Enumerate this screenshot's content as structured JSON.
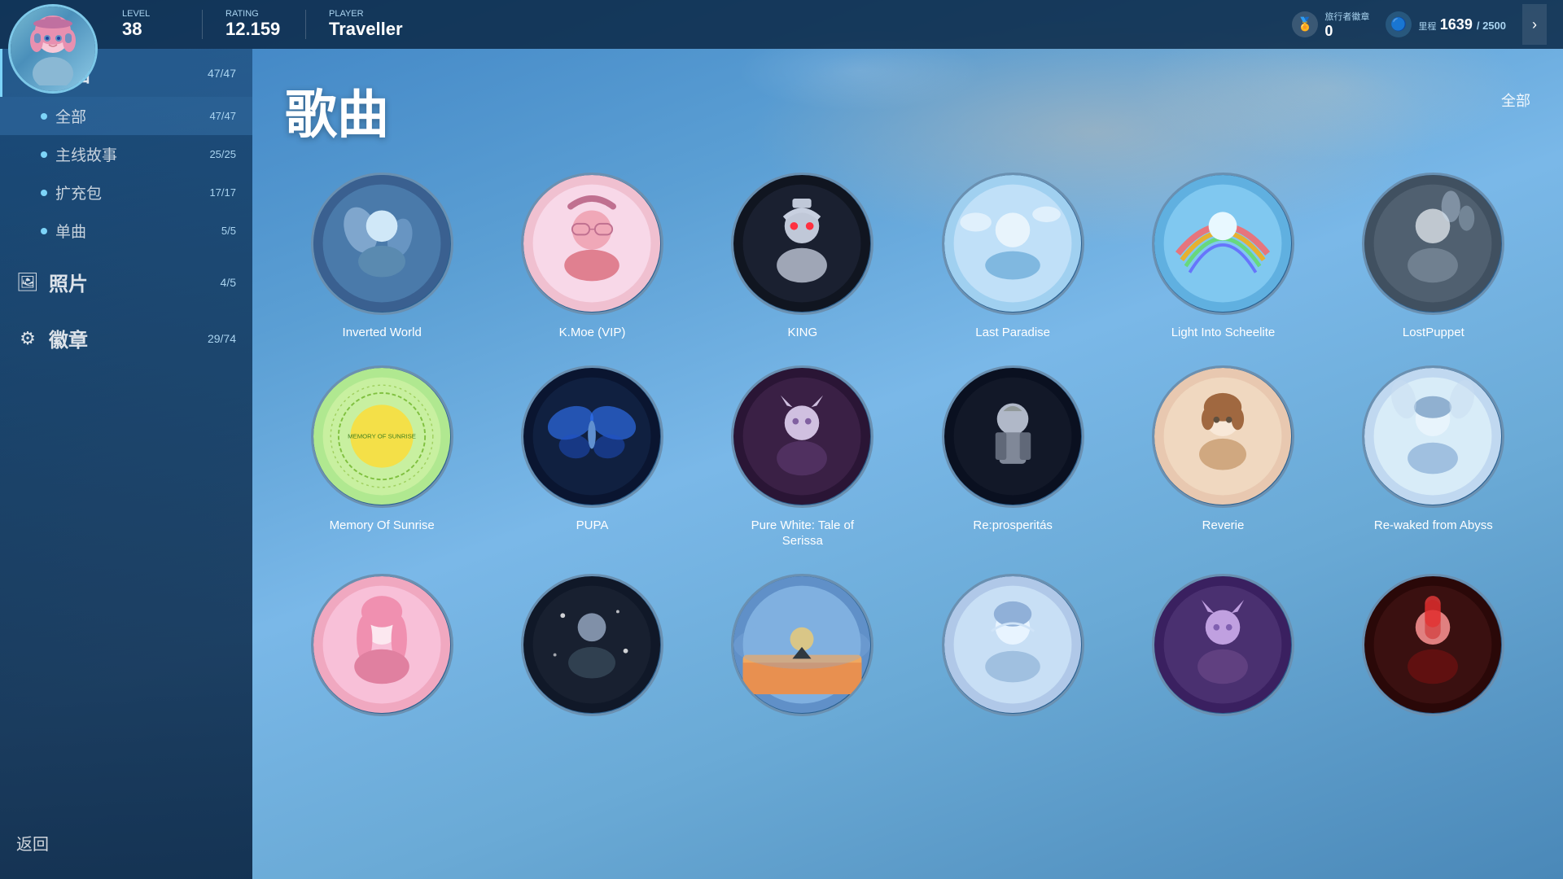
{
  "topbar": {
    "level_label": "Level",
    "level_value": "38",
    "rating_label": "Rating",
    "rating_value": "12.159",
    "player_label": "Player",
    "player_value": "Traveller",
    "badge_label": "旅行者徽章",
    "badge_value": "0",
    "mileage_label": "里程",
    "mileage_value": "1639",
    "mileage_max": "2500",
    "arrow_label": "›"
  },
  "sidebar": {
    "songs_label": "歌曲",
    "songs_count": "47/47",
    "sub_all_label": "全部",
    "sub_all_count": "47/47",
    "sub_main_label": "主线故事",
    "sub_main_count": "25/25",
    "sub_exp_label": "扩充包",
    "sub_exp_count": "17/17",
    "sub_single_label": "单曲",
    "sub_single_count": "5/5",
    "photos_label": "照片",
    "photos_count": "4/5",
    "badges_label": "徽章",
    "badges_count": "29/74",
    "back_label": "返回"
  },
  "main": {
    "title": "歌曲",
    "filter_label": "全部",
    "songs": [
      {
        "name": "Inverted World",
        "circle": "circle-1",
        "emoji": "🌊"
      },
      {
        "name": "K.Moe (VIP)",
        "circle": "circle-2",
        "emoji": "💫"
      },
      {
        "name": "KING",
        "circle": "circle-3",
        "emoji": "👑"
      },
      {
        "name": "Last Paradise",
        "circle": "circle-4",
        "emoji": "🌸"
      },
      {
        "name": "Light Into Scheelite",
        "circle": "circle-5",
        "emoji": "🌈"
      },
      {
        "name": "LostPuppet",
        "circle": "circle-6",
        "emoji": "🎭"
      },
      {
        "name": "Memory Of Sunrise",
        "circle": "circle-7",
        "emoji": "🌅"
      },
      {
        "name": "PUPA",
        "circle": "circle-8",
        "emoji": "🦋"
      },
      {
        "name": "Pure White: Tale of Serissa",
        "circle": "circle-9",
        "emoji": "🐱"
      },
      {
        "name": "Re:prosperitás",
        "circle": "circle-10",
        "emoji": "⚔️"
      },
      {
        "name": "Reverie",
        "circle": "circle-11",
        "emoji": "🌸"
      },
      {
        "name": "Re-waked from Abyss",
        "circle": "circle-12",
        "emoji": "🎀"
      },
      {
        "name": "",
        "circle": "circle-13",
        "emoji": "🌺"
      },
      {
        "name": "",
        "circle": "circle-14",
        "emoji": "✨"
      },
      {
        "name": "",
        "circle": "circle-15",
        "emoji": "🌠"
      },
      {
        "name": "",
        "circle": "circle-16",
        "emoji": "💎"
      },
      {
        "name": "",
        "circle": "circle-17",
        "emoji": "🔮"
      },
      {
        "name": "",
        "circle": "circle-18",
        "emoji": "🎌"
      }
    ]
  }
}
